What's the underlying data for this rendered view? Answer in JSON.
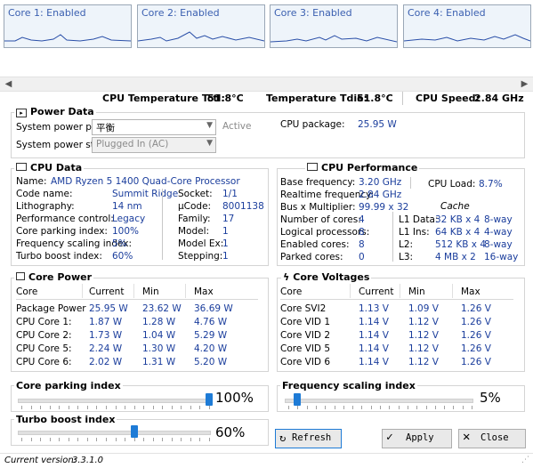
{
  "graphs": [
    {
      "label": "Core 1: Enabled"
    },
    {
      "label": "Core 2: Enabled"
    },
    {
      "label": "Core 3: Enabled"
    },
    {
      "label": "Core 4: Enabled"
    }
  ],
  "topbar": {
    "tctl_label": "CPU Temperature Tctl:",
    "tctl_value": "51.8°C",
    "tdie_label": "Temperature Tdie:",
    "tdie_value": "51.8°C",
    "speed_label": "CPU Speed:",
    "speed_value": "2.84 GHz"
  },
  "power_data": {
    "title": "Power Data",
    "plan_label": "System power plan:",
    "plan_value": "平衡",
    "plan_status": "Active",
    "state_label": "System power state:",
    "state_value": "Plugged In (AC)",
    "package_label": "CPU package:",
    "package_value": "25.95 W"
  },
  "cpu_data": {
    "title": "CPU Data",
    "name_label": "Name:",
    "name_value": "AMD Ryzen 5 1400 Quad-Core Processor",
    "rows": [
      {
        "l": "Code name:",
        "v": "Summit Ridge",
        "l2": "Socket:",
        "v2": "1/1"
      },
      {
        "l": "Lithography:",
        "v": "14 nm",
        "l2": "µCode:",
        "v2": "8001138"
      },
      {
        "l": "Performance control:",
        "v": "Legacy",
        "l2": "Family:",
        "v2": "17"
      },
      {
        "l": "Core parking index:",
        "v": "100%",
        "l2": "Model:",
        "v2": "1"
      },
      {
        "l": "Frequency scaling index:",
        "v": "5%",
        "l2": "Model Ex:",
        "v2": "1"
      },
      {
        "l": "Turbo boost index:",
        "v": "60%",
        "l2": "Stepping:",
        "v2": "1"
      }
    ]
  },
  "cpu_perf": {
    "title": "CPU Performance",
    "base_label": "Base frequency:",
    "base_value": "3.20 GHz",
    "load_label": "CPU Load:",
    "load_value": "8.7%",
    "rt_label": "Realtime frequency:",
    "rt_value": "2.84 GHz",
    "bus_label": "Bus x Multiplier:",
    "bus_value": "99.99 x 32",
    "cache_label": "Cache",
    "rows": [
      {
        "l": "Number of cores:",
        "v": "4",
        "cl": "L1 Data:",
        "cv": "32 KB x 4",
        "cw": "8-way"
      },
      {
        "l": "Logical processors:",
        "v": "8",
        "cl": "L1 Ins:",
        "cv": "64 KB x 4",
        "cw": "4-way"
      },
      {
        "l": "Enabled cores:",
        "v": "8",
        "cl": "L2:",
        "cv": "512 KB x 4",
        "cw": "8-way"
      },
      {
        "l": "Parked cores:",
        "v": "0",
        "cl": "L3:",
        "cv": "4 MB x 2",
        "cw": "16-way"
      }
    ]
  },
  "core_power": {
    "title": "Core Power",
    "headers": [
      "Core",
      "Current",
      "Min",
      "Max"
    ],
    "rows": [
      {
        "c": "Package Power",
        "cur": "25.95 W",
        "min": "23.62 W",
        "max": "36.69 W"
      },
      {
        "c": "CPU Core 1:",
        "cur": "1.87 W",
        "min": "1.28 W",
        "max": "4.76 W"
      },
      {
        "c": "CPU Core 2:",
        "cur": "1.73 W",
        "min": "1.04 W",
        "max": "5.29 W"
      },
      {
        "c": "CPU Core 5:",
        "cur": "2.24 W",
        "min": "1.30 W",
        "max": "4.20 W"
      },
      {
        "c": "CPU Core 6:",
        "cur": "2.02 W",
        "min": "1.31 W",
        "max": "5.20 W"
      }
    ]
  },
  "core_voltages": {
    "title": "Core Voltages",
    "headers": [
      "Core",
      "Current",
      "Min",
      "Max"
    ],
    "rows": [
      {
        "c": "Core SVI2",
        "cur": "1.13 V",
        "min": "1.09 V",
        "max": "1.26 V"
      },
      {
        "c": "Core VID 1",
        "cur": "1.14 V",
        "min": "1.12 V",
        "max": "1.26 V"
      },
      {
        "c": "Core VID 2",
        "cur": "1.14 V",
        "min": "1.12 V",
        "max": "1.26 V"
      },
      {
        "c": "Core VID 5",
        "cur": "1.14 V",
        "min": "1.12 V",
        "max": "1.26 V"
      },
      {
        "c": "Core VID 6",
        "cur": "1.14 V",
        "min": "1.12 V",
        "max": "1.26 V"
      }
    ]
  },
  "sliders": {
    "parking_label": "Core parking index",
    "parking_value": "100%",
    "parking_level": 1.0,
    "freq_label": "Frequency scaling index",
    "freq_value": "5%",
    "freq_level": 0.05,
    "turbo_label": "Turbo boost index",
    "turbo_value": "60%",
    "turbo_level": 0.6
  },
  "buttons": {
    "refresh": "Refresh",
    "apply": "Apply",
    "close": "Close"
  },
  "footer": {
    "version_label": "Current version:",
    "version_value": "3.3.1.0"
  },
  "colors": {
    "accent": "#1e7bd6",
    "value_blue": "#1a3d9c"
  }
}
